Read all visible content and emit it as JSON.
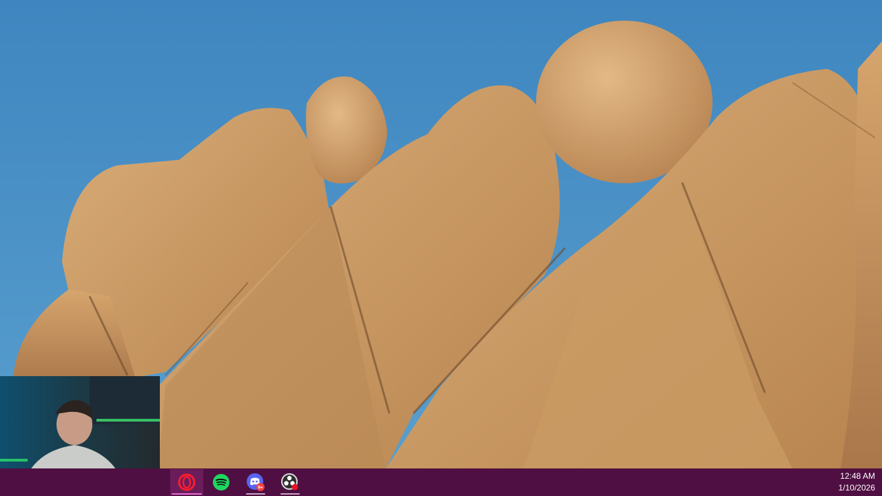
{
  "taskbar": {
    "apps": [
      {
        "name": "Opera",
        "icon": "opera-icon",
        "active": true
      },
      {
        "name": "Spotify",
        "icon": "spotify-icon",
        "active": false
      },
      {
        "name": "Discord",
        "icon": "discord-icon",
        "active": false,
        "badge": "9+"
      },
      {
        "name": "OBS Studio",
        "icon": "obs-icon",
        "active": false
      }
    ],
    "clock": {
      "time": "12:48 AM",
      "date": "1/10/2026"
    }
  },
  "colors": {
    "sky": "#4f93c6",
    "rock": "#c9965f",
    "taskbar": "#4f0f42",
    "active_tab": "#6a1d5a"
  }
}
